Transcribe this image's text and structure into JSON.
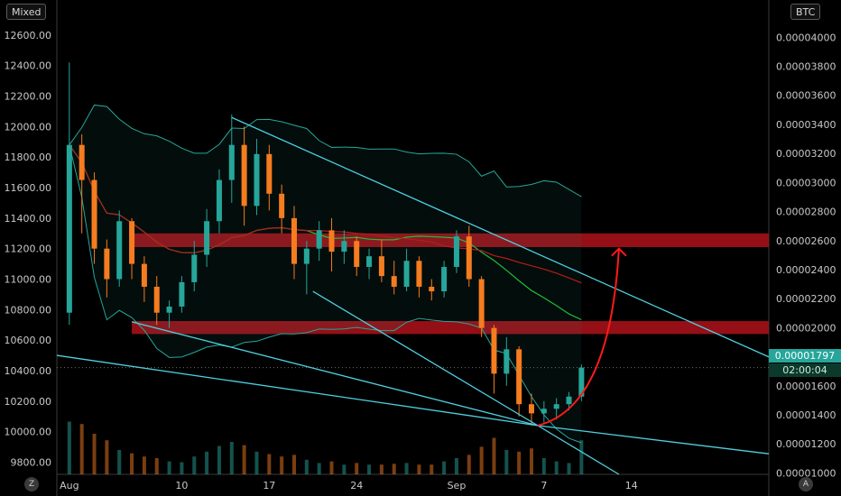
{
  "header": {
    "scale_mode": "Mixed",
    "quote_currency": "BTC"
  },
  "price_tags": {
    "last_price": "0.00001797",
    "countdown": "02:00:04"
  },
  "icons": {
    "timezone": "Z",
    "auto_scale": "A"
  },
  "colors": {
    "up": "#26a69a",
    "down": "#f57c1f",
    "support_zone": "#b5121b",
    "trendline": "#4dd0e1",
    "bollinger": "#26a69a",
    "ma_fast": "#1fbd3a",
    "ma_slow": "#b71c1c",
    "projection_arrow": "#ff1a1a"
  },
  "chart_data": {
    "type": "candlestick",
    "left_axis": {
      "ylim": [
        9720,
        12700
      ],
      "ticks": [
        "12600.00",
        "12400.00",
        "12200.00",
        "12000.00",
        "11800.00",
        "11600.00",
        "11400.00",
        "11200.00",
        "11000.00",
        "10800.00",
        "10600.00",
        "10400.00",
        "10200.00",
        "10000.00",
        "9800.00"
      ]
    },
    "right_axis": {
      "ylim": [
        9.9e-06,
        4.12e-05
      ],
      "ticks": [
        "0.00004000",
        "0.00003800",
        "0.00003600",
        "0.00003400",
        "0.00003200",
        "0.00003000",
        "0.00002800",
        "0.00002600",
        "0.00002400",
        "0.00002200",
        "0.00002000",
        "0.00001800",
        "0.00001600",
        "0.00001400",
        "0.00001200",
        "0.00001000"
      ]
    },
    "x_axis": {
      "labels": [
        "Aug",
        "10",
        "17",
        "24",
        "Sep",
        "7",
        "14"
      ],
      "day_index": [
        0,
        9,
        16,
        23,
        31,
        38,
        45
      ],
      "xlim": [
        -1,
        56
      ]
    },
    "resistance_zones_left_axis": [
      [
        11210,
        11300
      ],
      [
        10640,
        10725
      ]
    ],
    "trendlines_left_axis": [
      {
        "from": [
          13,
          12060
        ],
        "to": [
          56,
          10490
        ]
      },
      {
        "from": [
          19.5,
          10920
        ],
        "to": [
          37.5,
          10040
        ]
      },
      {
        "from": [
          5,
          10720
        ],
        "to": [
          37.5,
          10040
        ]
      },
      {
        "from": [
          -1,
          10500
        ],
        "to": [
          37.5,
          10040
        ]
      },
      {
        "from": [
          37.5,
          10040
        ],
        "to": [
          56,
          9855
        ]
      },
      {
        "from": [
          37.5,
          10040
        ],
        "to": [
          44,
          9720
        ]
      }
    ],
    "projection_arrow": {
      "start": [
        37.5,
        10040
      ],
      "end": [
        44,
        11200
      ]
    },
    "candles": [
      {
        "o": 10780,
        "h": 12420,
        "l": 10700,
        "c": 11880,
        "v": 0.65
      },
      {
        "o": 11880,
        "h": 11950,
        "l": 11300,
        "c": 11650,
        "v": 0.62
      },
      {
        "o": 11650,
        "h": 11700,
        "l": 11100,
        "c": 11200,
        "v": 0.5
      },
      {
        "o": 11200,
        "h": 11260,
        "l": 10880,
        "c": 11000,
        "v": 0.42
      },
      {
        "o": 11000,
        "h": 11450,
        "l": 10950,
        "c": 11380,
        "v": 0.3
      },
      {
        "o": 11380,
        "h": 11400,
        "l": 11000,
        "c": 11100,
        "v": 0.26
      },
      {
        "o": 11100,
        "h": 11150,
        "l": 10850,
        "c": 10950,
        "v": 0.22
      },
      {
        "o": 10950,
        "h": 11020,
        "l": 10700,
        "c": 10780,
        "v": 0.2
      },
      {
        "o": 10780,
        "h": 10860,
        "l": 10680,
        "c": 10820,
        "v": 0.16
      },
      {
        "o": 10820,
        "h": 11020,
        "l": 10780,
        "c": 10980,
        "v": 0.15
      },
      {
        "o": 10980,
        "h": 11250,
        "l": 10920,
        "c": 11160,
        "v": 0.22
      },
      {
        "o": 11160,
        "h": 11460,
        "l": 11080,
        "c": 11380,
        "v": 0.28
      },
      {
        "o": 11380,
        "h": 11720,
        "l": 11300,
        "c": 11650,
        "v": 0.35
      },
      {
        "o": 11650,
        "h": 12080,
        "l": 11500,
        "c": 11880,
        "v": 0.4
      },
      {
        "o": 11880,
        "h": 12000,
        "l": 11350,
        "c": 11480,
        "v": 0.36
      },
      {
        "o": 11480,
        "h": 11920,
        "l": 11420,
        "c": 11820,
        "v": 0.28
      },
      {
        "o": 11820,
        "h": 11880,
        "l": 11450,
        "c": 11560,
        "v": 0.25
      },
      {
        "o": 11560,
        "h": 11620,
        "l": 11300,
        "c": 11400,
        "v": 0.22
      },
      {
        "o": 11400,
        "h": 11480,
        "l": 11000,
        "c": 11100,
        "v": 0.24
      },
      {
        "o": 11100,
        "h": 11250,
        "l": 10900,
        "c": 11200,
        "v": 0.18
      },
      {
        "o": 11200,
        "h": 11380,
        "l": 11120,
        "c": 11320,
        "v": 0.14
      },
      {
        "o": 11320,
        "h": 11400,
        "l": 11050,
        "c": 11180,
        "v": 0.16
      },
      {
        "o": 11180,
        "h": 11320,
        "l": 11100,
        "c": 11250,
        "v": 0.12
      },
      {
        "o": 11250,
        "h": 11280,
        "l": 11020,
        "c": 11080,
        "v": 0.14
      },
      {
        "o": 11080,
        "h": 11200,
        "l": 11000,
        "c": 11150,
        "v": 0.12
      },
      {
        "o": 11150,
        "h": 11260,
        "l": 10980,
        "c": 11020,
        "v": 0.12
      },
      {
        "o": 11020,
        "h": 11120,
        "l": 10900,
        "c": 10950,
        "v": 0.13
      },
      {
        "o": 10950,
        "h": 11200,
        "l": 10920,
        "c": 11120,
        "v": 0.14
      },
      {
        "o": 11120,
        "h": 11150,
        "l": 10880,
        "c": 10950,
        "v": 0.12
      },
      {
        "o": 10950,
        "h": 11000,
        "l": 10860,
        "c": 10920,
        "v": 0.12
      },
      {
        "o": 10920,
        "h": 11120,
        "l": 10880,
        "c": 11080,
        "v": 0.16
      },
      {
        "o": 11080,
        "h": 11320,
        "l": 11040,
        "c": 11280,
        "v": 0.2
      },
      {
        "o": 11280,
        "h": 11350,
        "l": 10950,
        "c": 11000,
        "v": 0.24
      },
      {
        "o": 11000,
        "h": 11020,
        "l": 10620,
        "c": 10680,
        "v": 0.34
      },
      {
        "o": 10680,
        "h": 10700,
        "l": 10250,
        "c": 10380,
        "v": 0.45
      },
      {
        "o": 10380,
        "h": 10620,
        "l": 10300,
        "c": 10540,
        "v": 0.3
      },
      {
        "o": 10540,
        "h": 10560,
        "l": 10100,
        "c": 10180,
        "v": 0.28
      },
      {
        "o": 10180,
        "h": 10250,
        "l": 10040,
        "c": 10120,
        "v": 0.32
      },
      {
        "o": 10120,
        "h": 10200,
        "l": 10060,
        "c": 10150,
        "v": 0.2
      },
      {
        "o": 10150,
        "h": 10220,
        "l": 10080,
        "c": 10180,
        "v": 0.16
      },
      {
        "o": 10180,
        "h": 10260,
        "l": 10140,
        "c": 10230,
        "v": 0.14
      },
      {
        "o": 10230,
        "h": 10440,
        "l": 10200,
        "c": 10420,
        "v": 0.42
      }
    ]
  }
}
